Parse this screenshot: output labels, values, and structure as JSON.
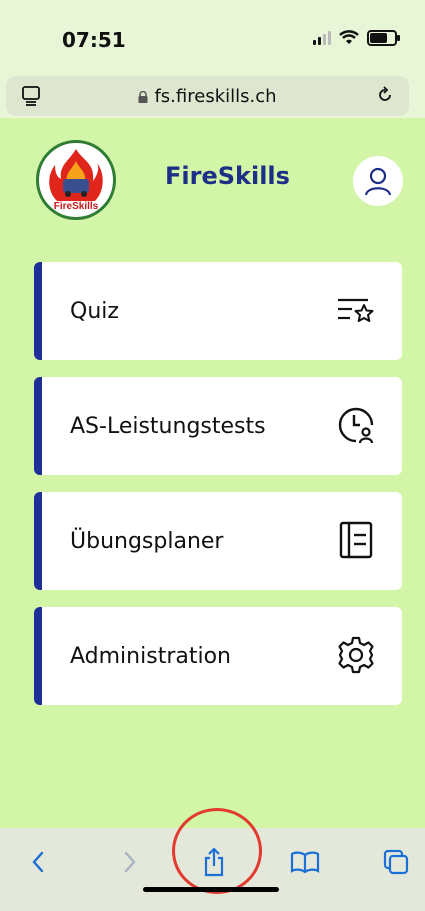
{
  "status_bar": {
    "time": "07:51"
  },
  "browser": {
    "url": "fs.fireskills.ch"
  },
  "header": {
    "app_title": "FireSkills",
    "logo_text": "FireSkills"
  },
  "menu": {
    "items": [
      {
        "label": "Quiz",
        "icon": "list-star-icon"
      },
      {
        "label": "AS-Leistungstests",
        "icon": "clock-user-icon"
      },
      {
        "label": "Übungsplaner",
        "icon": "planner-icon"
      },
      {
        "label": "Administration",
        "icon": "gear-icon"
      }
    ]
  },
  "toolbar": {
    "icons": [
      "back-icon",
      "forward-icon",
      "share-icon",
      "bookmarks-icon",
      "tabs-icon"
    ]
  },
  "colors": {
    "page_background": "#d2f5a7",
    "accent": "#1f2f9a",
    "title": "#1d2f86",
    "highlight": "#e23a2e"
  }
}
